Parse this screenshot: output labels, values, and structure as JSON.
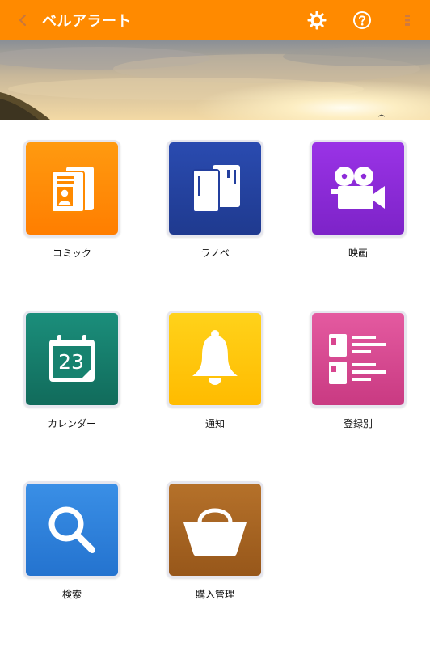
{
  "app_bar": {
    "title": "ベルアラート",
    "background_color": "#ff8a00",
    "icons": {
      "back": "chevron-left-icon",
      "settings": "gear-icon",
      "help": "help-icon",
      "menu": "menu-icon"
    }
  },
  "menu": {
    "items": [
      {
        "label": "コミック",
        "icon": "comic-card-icon",
        "color": "#ff8a00"
      },
      {
        "label": "ラノベ",
        "icon": "light-novel-icon",
        "color": "#233f9e"
      },
      {
        "label": "映画",
        "icon": "movie-camera-icon",
        "color": "#8e2bd9"
      },
      {
        "label": "カレンダー",
        "icon": "calendar-icon",
        "color": "#17826f",
        "calendar_day": "23"
      },
      {
        "label": "通知",
        "icon": "bell-icon",
        "color": "#ffc400"
      },
      {
        "label": "登録別",
        "icon": "register-list-icon",
        "color": "#d8458f"
      },
      {
        "label": "検索",
        "icon": "search-icon",
        "color": "#2f7fdb"
      },
      {
        "label": "購入管理",
        "icon": "shopping-basket-icon",
        "color": "#a8641f"
      }
    ]
  }
}
